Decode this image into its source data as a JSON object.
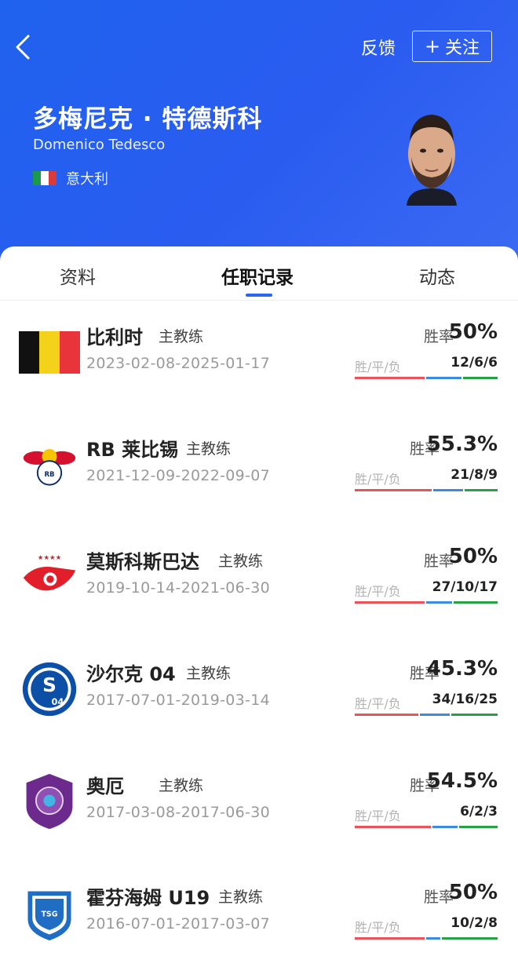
{
  "header": {
    "feedback_label": "反馈",
    "follow_plus": "+",
    "follow_label": "关注",
    "name_cn": "多梅尼克 · 特德斯科",
    "name_en": "Domenico Tedesco",
    "nationality": "意大利",
    "colors": {
      "bg": "#2a5cf0"
    }
  },
  "tabs": [
    {
      "label": "资料"
    },
    {
      "label": "任职记录",
      "active": true
    },
    {
      "label": "动态"
    }
  ],
  "labels": {
    "win_rate": "胜率",
    "wdl": "胜/平/负"
  },
  "records": [
    {
      "team": "比利时",
      "role": "主教练",
      "dates": "2023-02-08-2025-01-17",
      "win_rate": "50%",
      "wdl": "12/6/6",
      "w": 12,
      "d": 6,
      "l": 6,
      "logo": "belgium-flag-icon"
    },
    {
      "team": "RB 莱比锡",
      "role": "主教练",
      "dates": "2021-12-09-2022-09-07",
      "win_rate": "55.3%",
      "wdl": "21/8/9",
      "w": 21,
      "d": 8,
      "l": 9,
      "logo": "rb-leipzig-logo-icon"
    },
    {
      "team": "莫斯科斯巴达",
      "role": "主教练",
      "dates": "2019-10-14-2021-06-30",
      "win_rate": "50%",
      "wdl": "27/10/17",
      "w": 27,
      "d": 10,
      "l": 17,
      "logo": "spartak-moscow-logo-icon"
    },
    {
      "team": "沙尔克 04",
      "role": "主教练",
      "dates": "2017-07-01-2019-03-14",
      "win_rate": "45.3%",
      "wdl": "34/16/25",
      "w": 34,
      "d": 16,
      "l": 25,
      "logo": "schalke-04-logo-icon"
    },
    {
      "team": "奥厄",
      "role": "主教练",
      "dates": "2017-03-08-2017-06-30",
      "win_rate": "54.5%",
      "wdl": "6/2/3",
      "w": 6,
      "d": 2,
      "l": 3,
      "logo": "erzgebirge-aue-logo-icon"
    },
    {
      "team": "霍芬海姆 U19",
      "role": "主教练",
      "dates": "2016-07-01-2017-03-07",
      "win_rate": "50%",
      "wdl": "10/2/8",
      "w": 10,
      "d": 2,
      "l": 8,
      "logo": "hoffenheim-logo-icon"
    }
  ]
}
